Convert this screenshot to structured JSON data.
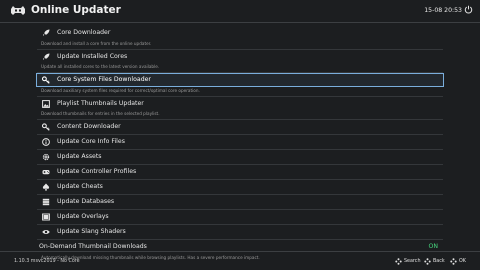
{
  "header": {
    "title": "Online Updater",
    "clock": "15-08 20:53"
  },
  "menu": {
    "items": [
      {
        "label": "Core Downloader",
        "icon": "rocket-icon",
        "sub": "Download and install a core from the online updater."
      },
      {
        "label": "Update Installed Cores",
        "icon": "rocket-icon",
        "sub": "Update all installed cores to the latest version available."
      },
      {
        "label": "Core System Files Downloader",
        "icon": "key-icon",
        "sub": "Download auxiliary system files required for correct/optimal core operation.",
        "selected": true
      },
      {
        "label": "Playlist Thumbnails Updater",
        "icon": "image-icon",
        "sub": "Download thumbnails for entries in the selected playlist."
      },
      {
        "label": "Content Downloader",
        "icon": "key-icon"
      },
      {
        "label": "Update Core Info Files",
        "icon": "info-icon"
      },
      {
        "label": "Update Assets",
        "icon": "gear-icon"
      },
      {
        "label": "Update Controller Profiles",
        "icon": "gamepad-icon"
      },
      {
        "label": "Update Cheats",
        "icon": "spade-icon"
      },
      {
        "label": "Update Databases",
        "icon": "database-icon"
      },
      {
        "label": "Update Overlays",
        "icon": "layers-icon"
      },
      {
        "label": "Update Slang Shaders",
        "icon": "eye-icon"
      }
    ],
    "toggle": {
      "label": "On-Demand Thumbnail Downloads",
      "value": "ON",
      "sub": "Automatically download missing thumbnails while browsing playlists. Has a severe performance impact."
    }
  },
  "footer": {
    "version": "1.10.3 msvc2019 - No Core",
    "hints": {
      "search": "Search",
      "back": "Back",
      "ok": "OK"
    }
  },
  "colors": {
    "background": "#1c1e20",
    "selection": "#7aaedc",
    "toggle_on": "#46d77e",
    "divider": "#3c3f42"
  }
}
